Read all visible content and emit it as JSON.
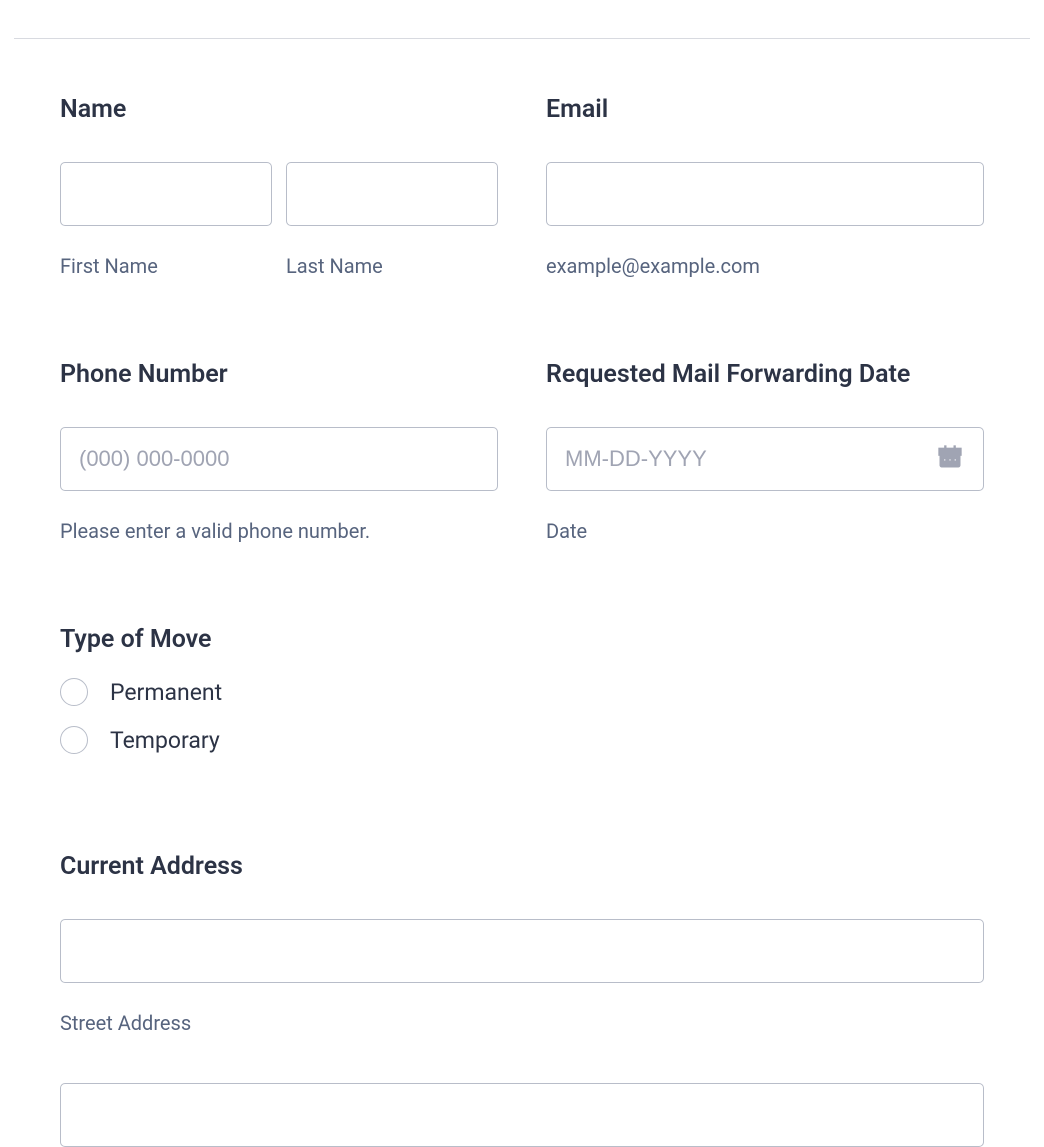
{
  "name": {
    "label": "Name",
    "first_sublabel": "First Name",
    "last_sublabel": "Last Name"
  },
  "email": {
    "label": "Email",
    "sublabel": "example@example.com"
  },
  "phone": {
    "label": "Phone Number",
    "placeholder": "(000) 000-0000",
    "sublabel": "Please enter a valid phone number."
  },
  "forwarding_date": {
    "label": "Requested Mail Forwarding Date",
    "placeholder": "MM-DD-YYYY",
    "sublabel": "Date"
  },
  "type_move": {
    "label": "Type of Move",
    "option_permanent": "Permanent",
    "option_temporary": "Temporary"
  },
  "current_address": {
    "label": "Current Address",
    "street_sublabel": "Street Address"
  }
}
